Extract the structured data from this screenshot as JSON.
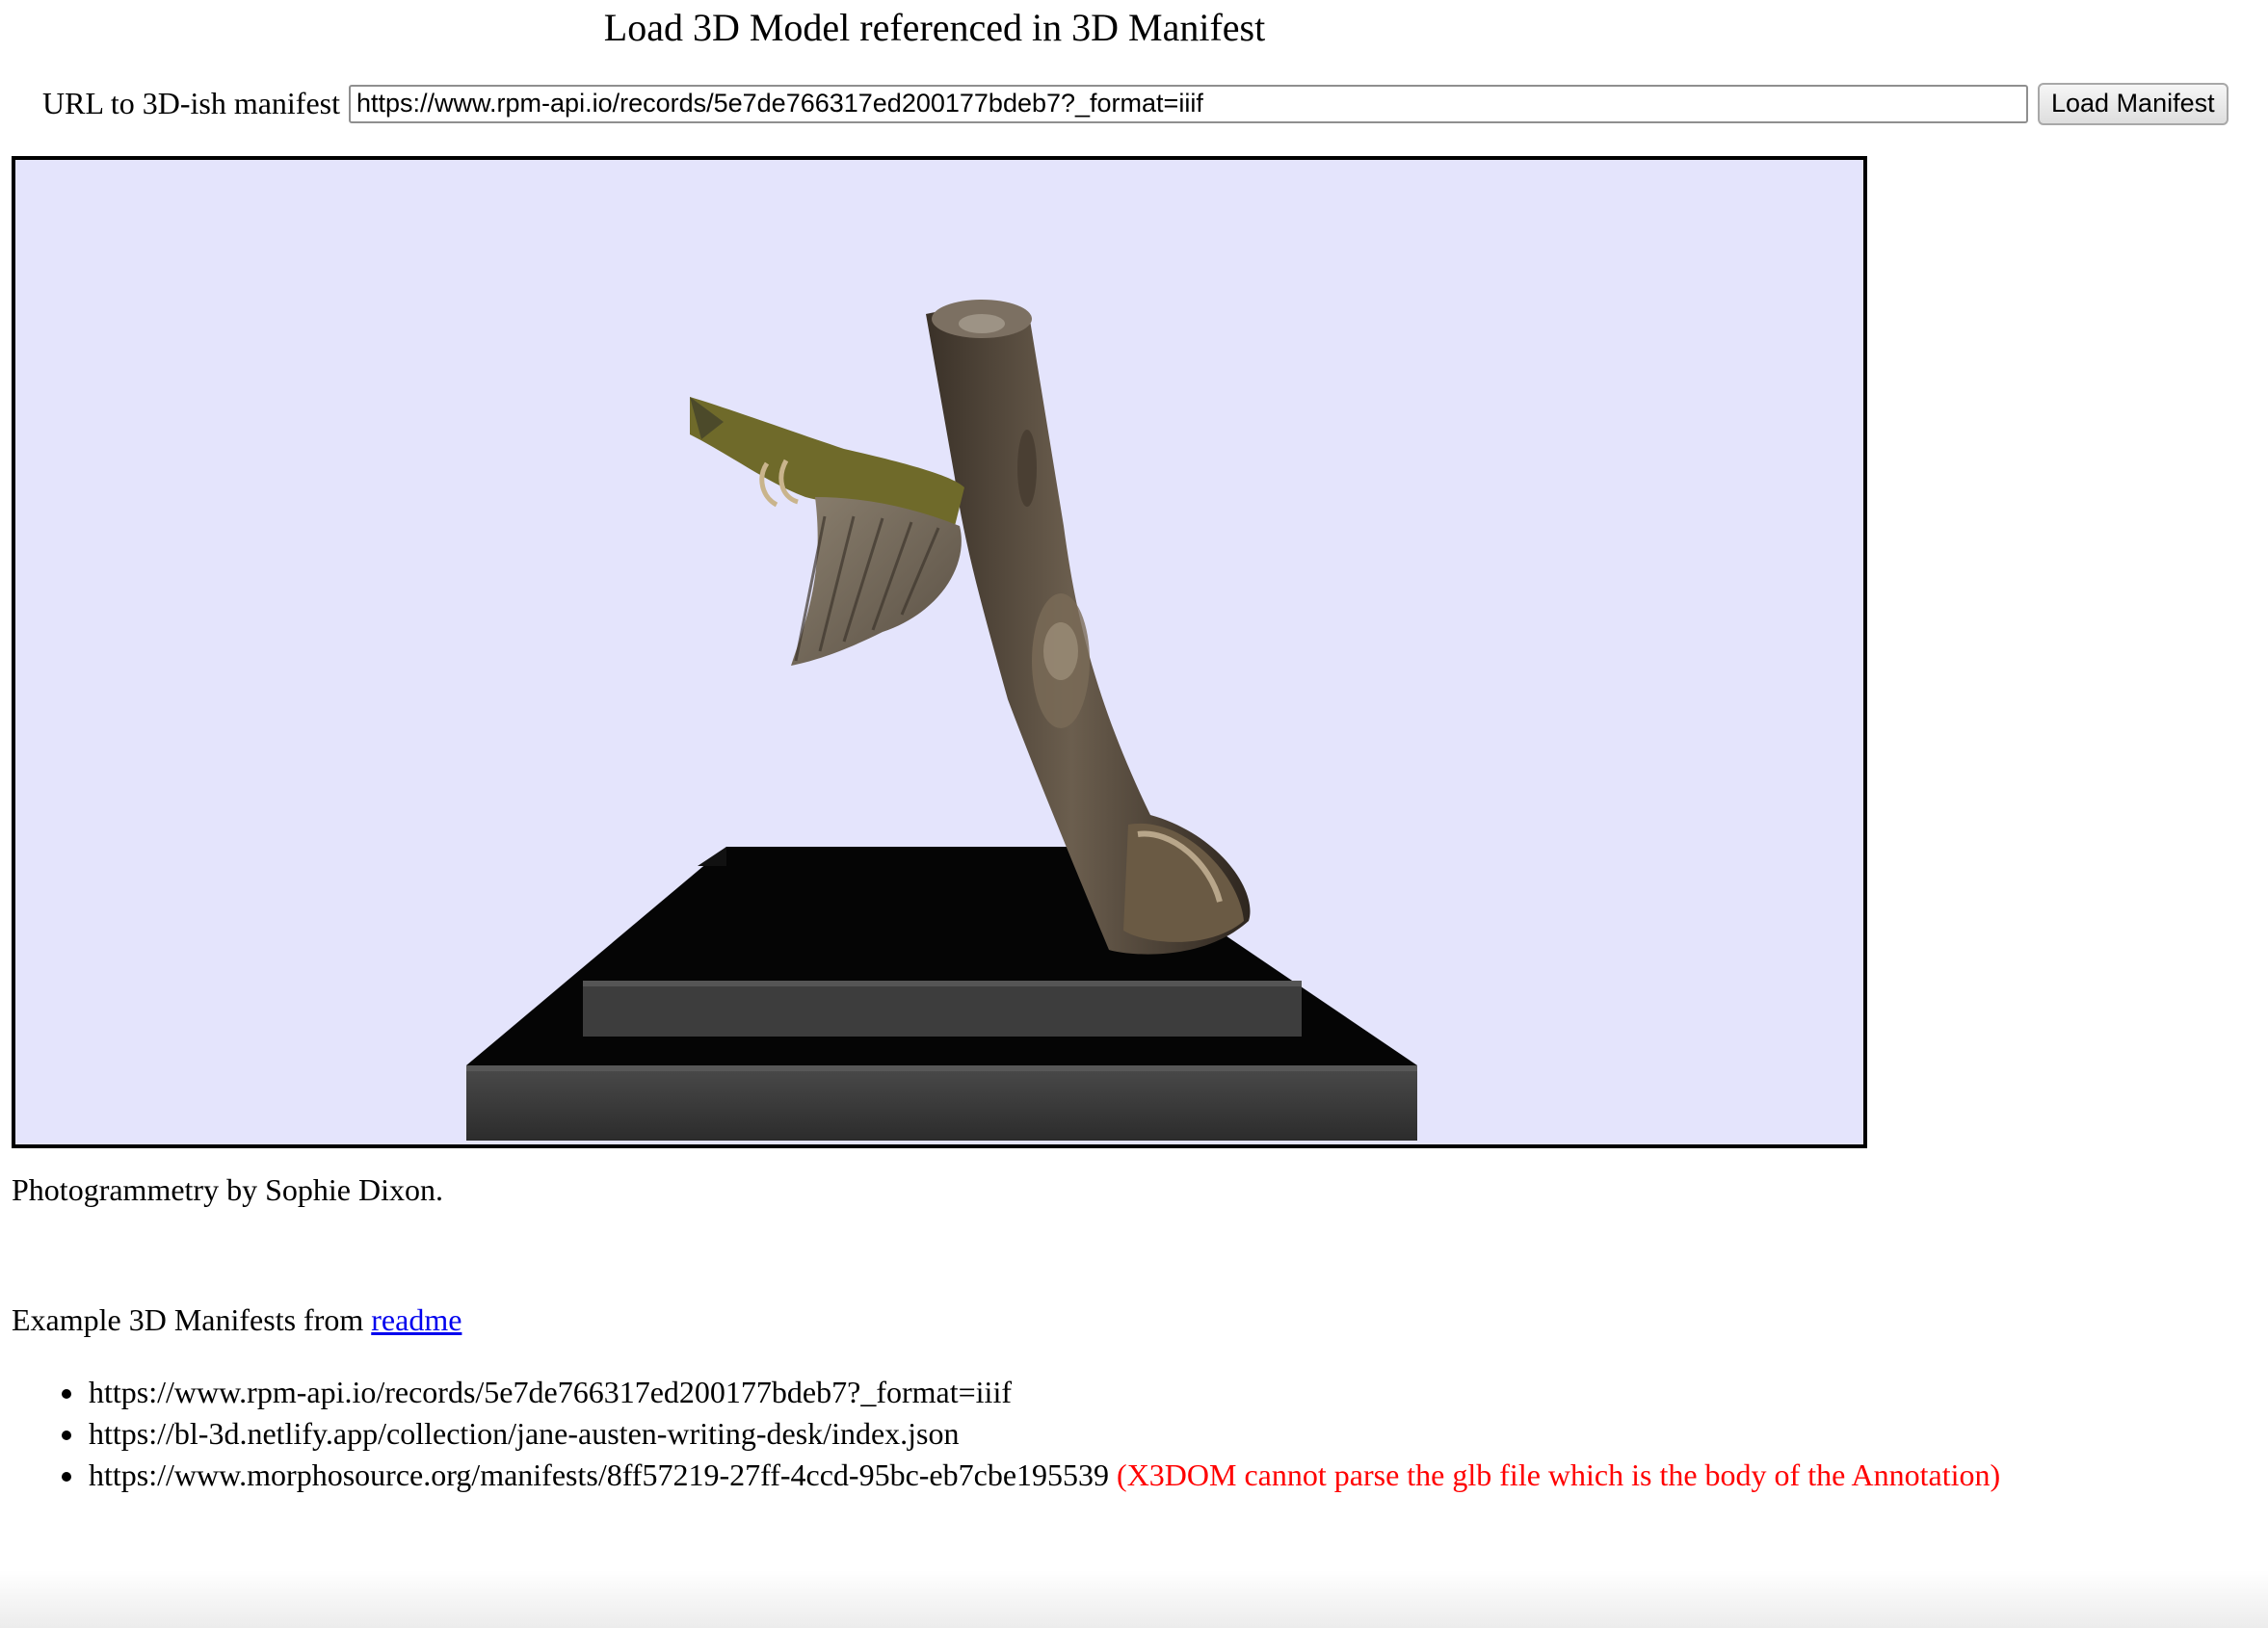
{
  "page": {
    "title": "Load 3D Model referenced in 3D Manifest"
  },
  "url_form": {
    "label": "URL to 3D-ish manifest",
    "value": "https://www.rpm-api.io/records/5e7de766317ed200177bdeb7?_format=iiif",
    "button_label": "Load Manifest"
  },
  "viewer": {
    "background_color": "#e4e4fc",
    "model": "bird-on-branch-on-stand"
  },
  "credit": "Photogrammetry by Sophie Dixon.",
  "examples": {
    "heading_text": "Example 3D Manifests from",
    "link_text": "readme",
    "items": [
      {
        "url": "https://www.rpm-api.io/records/5e7de766317ed200177bdeb7?_format=iiif",
        "note": ""
      },
      {
        "url": "https://bl-3d.netlify.app/collection/jane-austen-writing-desk/index.json",
        "note": ""
      },
      {
        "url": "https://www.morphosource.org/manifests/8ff57219-27ff-4ccd-95bc-eb7cbe195539",
        "note": "(X3DOM cannot parse the glb file which is the body of the Annotation)"
      }
    ],
    "note_color": "#ff0000"
  }
}
